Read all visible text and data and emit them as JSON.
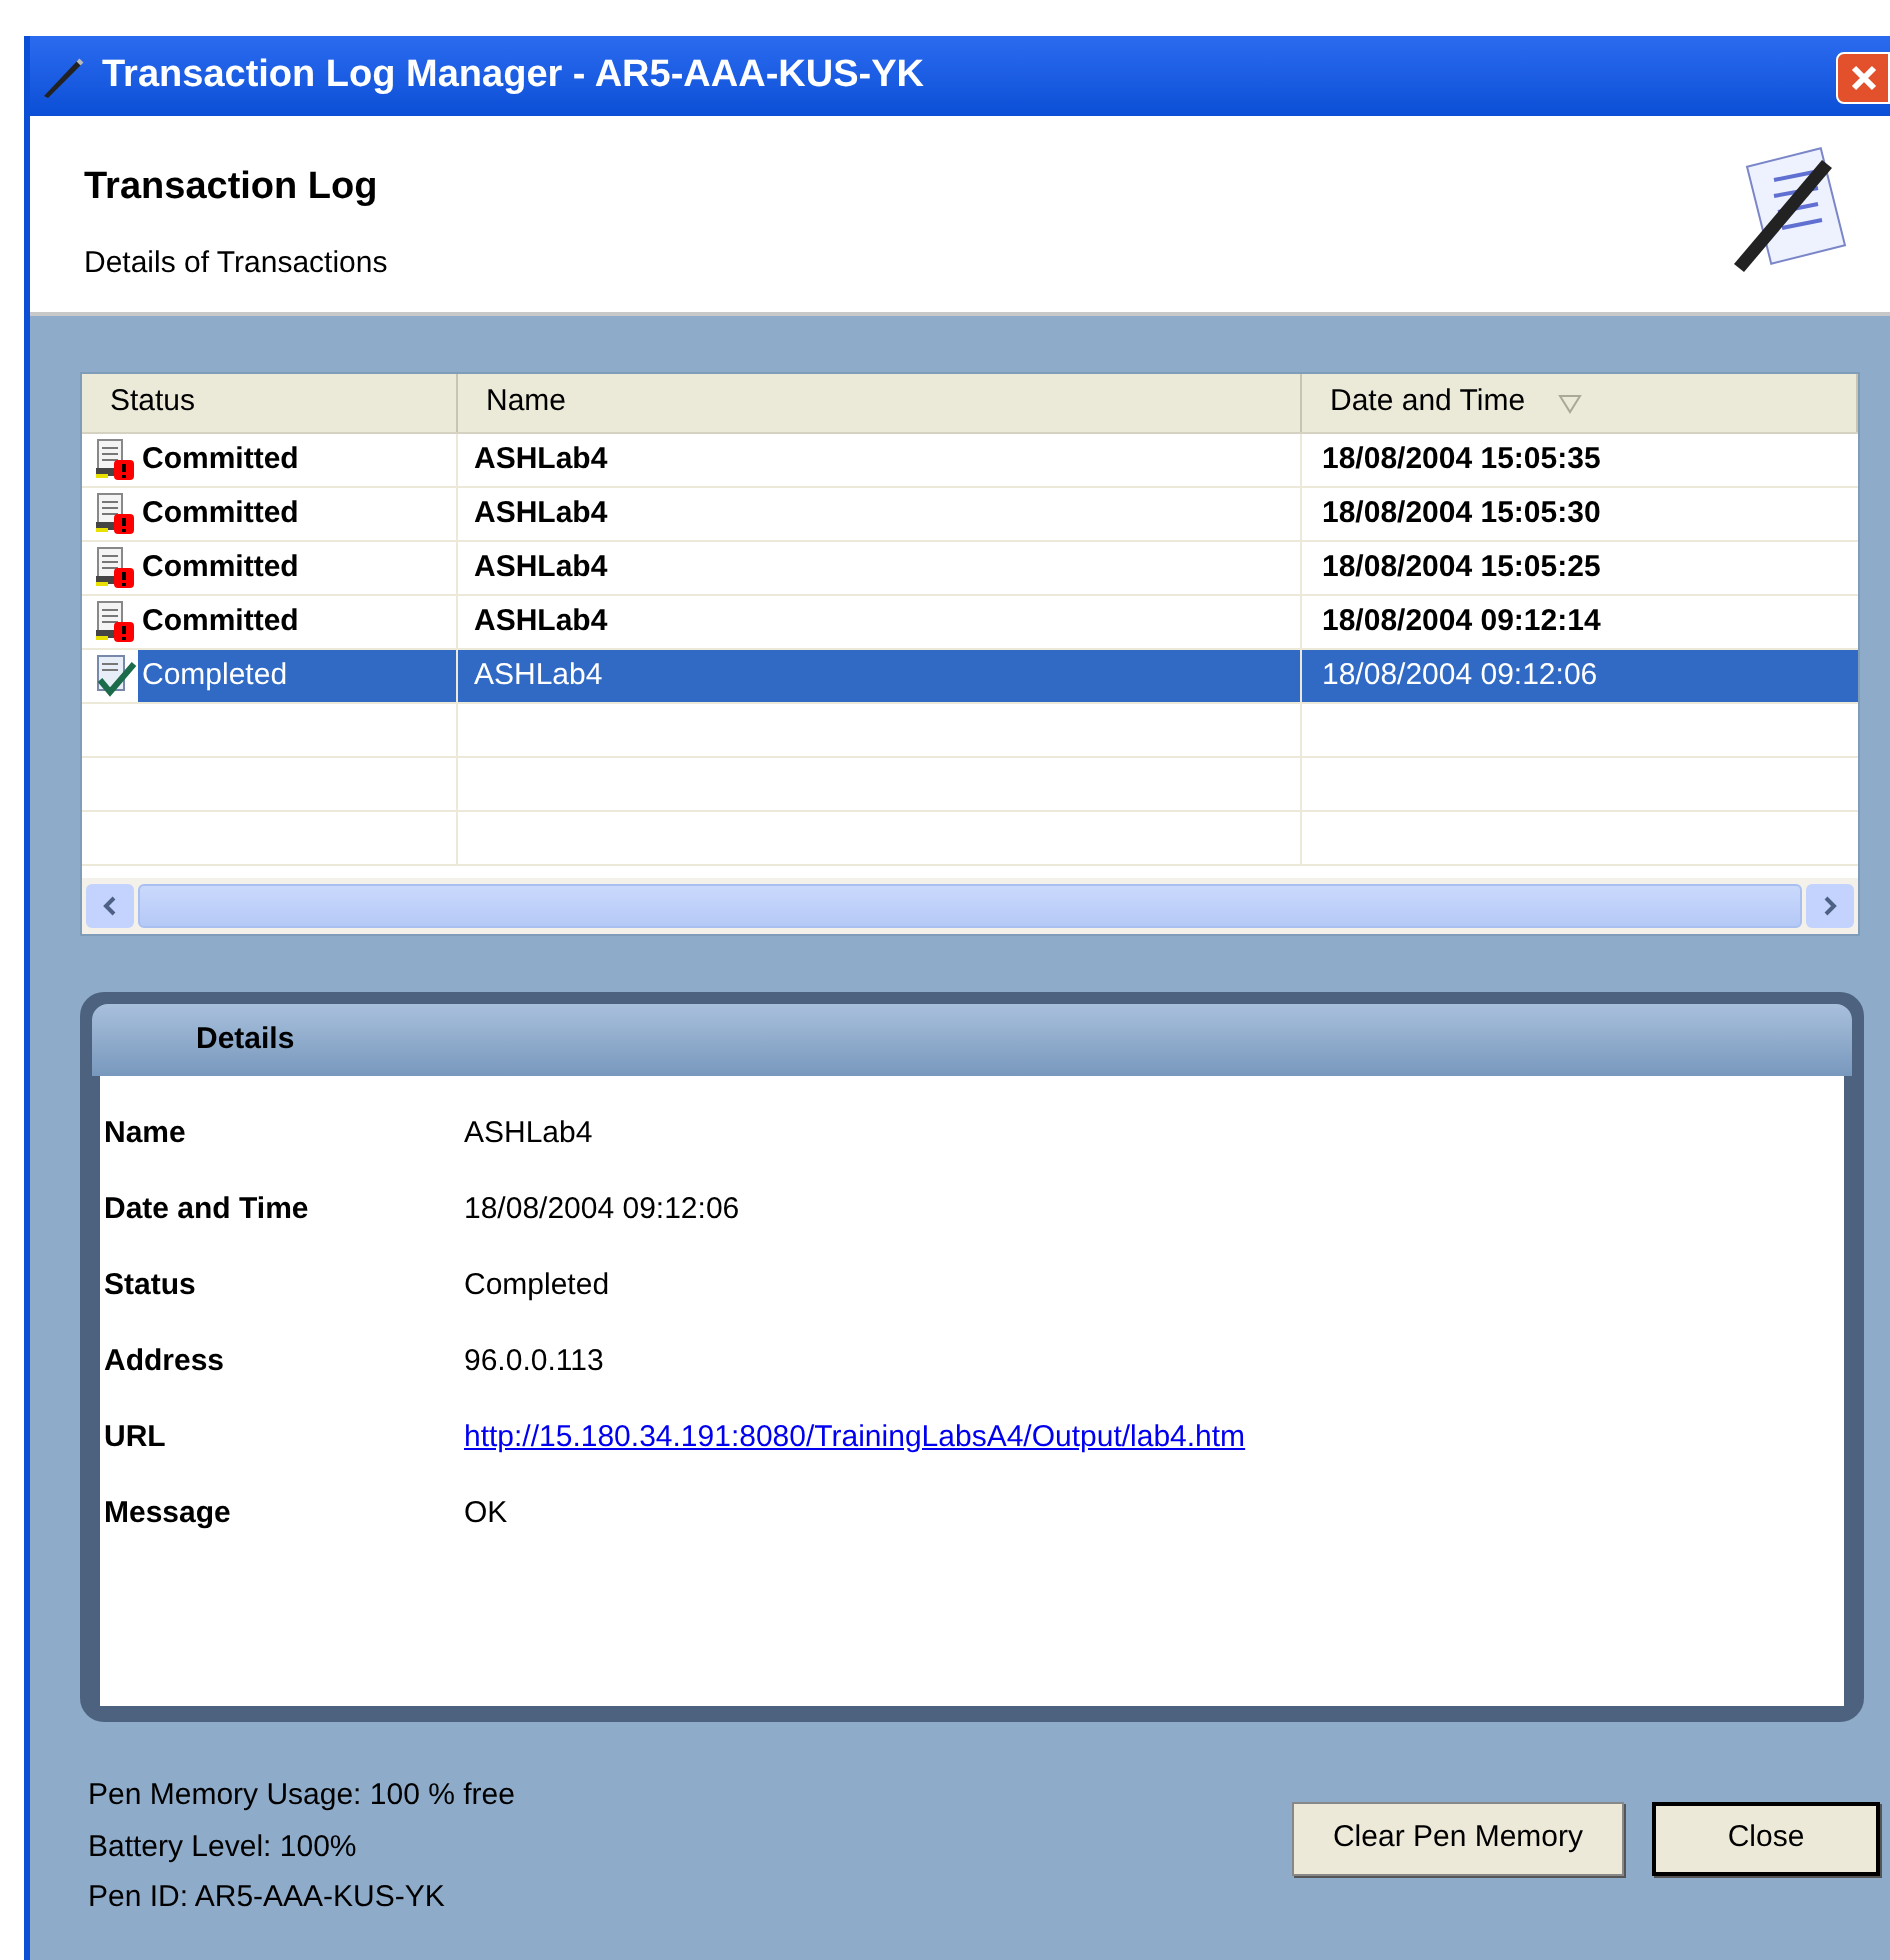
{
  "window": {
    "title": "Transaction Log Manager - AR5-AAA-KUS-YK"
  },
  "header": {
    "title": "Transaction Log",
    "subtitle": "Details of Transactions"
  },
  "table": {
    "columns": [
      {
        "label": "Status",
        "sorted": false
      },
      {
        "label": "Name",
        "sorted": false
      },
      {
        "label": "Date and Time",
        "sorted": true
      }
    ],
    "rows": [
      {
        "kind": "committed",
        "status": "Committed",
        "name": "ASHLab4",
        "date": "18/08/2004 15:05:35",
        "selected": false
      },
      {
        "kind": "committed",
        "status": "Committed",
        "name": "ASHLab4",
        "date": "18/08/2004 15:05:30",
        "selected": false
      },
      {
        "kind": "committed",
        "status": "Committed",
        "name": "ASHLab4",
        "date": "18/08/2004 15:05:25",
        "selected": false
      },
      {
        "kind": "committed",
        "status": "Committed",
        "name": "ASHLab4",
        "date": "18/08/2004 09:12:14",
        "selected": false
      },
      {
        "kind": "completed",
        "status": "Completed",
        "name": "ASHLab4",
        "date": "18/08/2004 09:12:06",
        "selected": true
      }
    ]
  },
  "details": {
    "title": "Details",
    "fields": [
      {
        "kind": "text",
        "label": "Name",
        "value": "ASHLab4"
      },
      {
        "kind": "text",
        "label": "Date and Time",
        "value": "18/08/2004 09:12:06"
      },
      {
        "kind": "text",
        "label": "Status",
        "value": "Completed"
      },
      {
        "kind": "text",
        "label": "Address",
        "value": "96.0.0.113"
      },
      {
        "kind": "link",
        "label": "URL",
        "value": "http://15.180.34.191:8080/TrainingLabsA4/Output/lab4.htm"
      },
      {
        "kind": "text",
        "label": "Message",
        "value": "OK"
      }
    ]
  },
  "footer": {
    "info": [
      "Pen Memory Usage: 100 % free",
      "Battery Level: 100%",
      "Pen ID: AR5-AAA-KUS-YK"
    ],
    "buttons": [
      "Clear Pen Memory",
      "Close"
    ]
  }
}
